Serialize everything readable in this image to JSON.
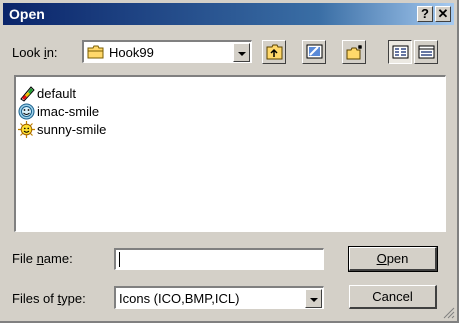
{
  "window": {
    "title": "Open",
    "help_glyph": "?",
    "close_glyph": "✕"
  },
  "lookin": {
    "label_pre": "Look ",
    "label_key": "i",
    "label_post": "n:",
    "folder_icon": "folder-icon",
    "value": "Hook99"
  },
  "toolbar": {
    "icons": [
      "up-folder-icon",
      "desktop-icon",
      "new-folder-icon",
      "list-view-icon",
      "details-view-icon"
    ]
  },
  "files": [
    {
      "name": "default",
      "icon": "default-icon"
    },
    {
      "name": "imac-smile",
      "icon": "imac-smile-icon"
    },
    {
      "name": "sunny-smile",
      "icon": "sunny-smile-icon"
    }
  ],
  "filename": {
    "label_pre": "File ",
    "label_key": "n",
    "label_post": "ame:",
    "value": ""
  },
  "filetype": {
    "label_pre": "Files of ",
    "label_key": "t",
    "label_post": "ype:",
    "value": "Icons (ICO,BMP,ICL)"
  },
  "buttons": {
    "open_key": "O",
    "open_rest": "pen",
    "cancel": "Cancel"
  }
}
